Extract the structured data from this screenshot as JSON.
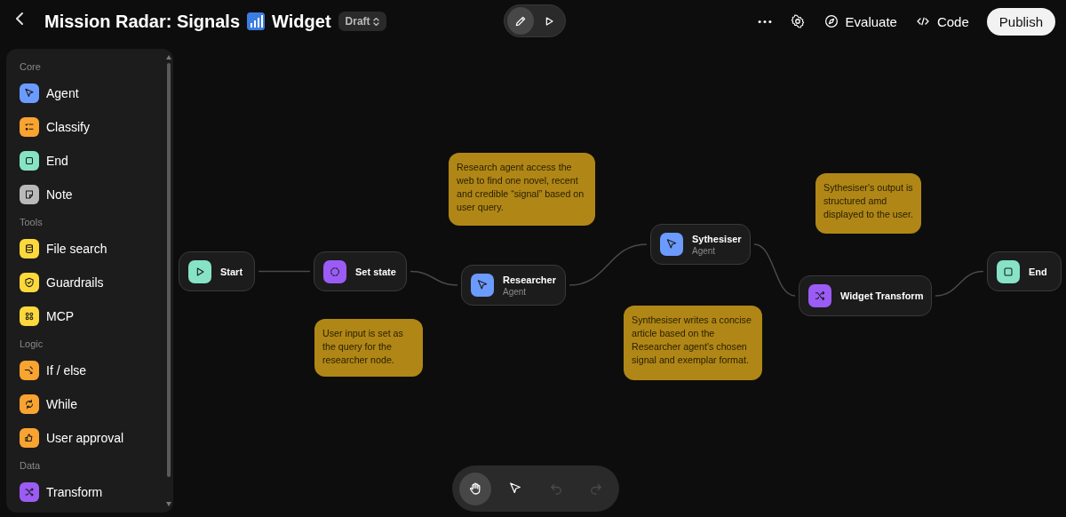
{
  "header": {
    "title_parts": [
      "Mission Radar: Signals",
      "Widget"
    ],
    "status": "Draft",
    "modes": [
      {
        "kind": "edit",
        "selected": true
      },
      {
        "kind": "run",
        "selected": false
      }
    ],
    "actions": [
      {
        "kind": "more"
      },
      {
        "kind": "settings"
      },
      {
        "kind": "evaluate",
        "label": "Evaluate"
      },
      {
        "kind": "code",
        "label": "Code"
      },
      {
        "kind": "publish",
        "label": "Publish"
      }
    ]
  },
  "sidebar": {
    "sections": [
      {
        "title": "Core",
        "items": [
          {
            "label": "Agent",
            "kind": "agent",
            "color": "#6c9bff"
          },
          {
            "label": "Classify",
            "kind": "classify",
            "color": "#f9a431"
          },
          {
            "label": "End",
            "kind": "end",
            "color": "#86e3c5"
          },
          {
            "label": "Note",
            "kind": "note",
            "color": "#b9b9b9"
          }
        ]
      },
      {
        "title": "Tools",
        "items": [
          {
            "label": "File search",
            "kind": "file-search",
            "color": "#fbd83c"
          },
          {
            "label": "Guardrails",
            "kind": "guardrails",
            "color": "#fbd83c"
          },
          {
            "label": "MCP",
            "kind": "mcp",
            "color": "#fbd83c"
          }
        ]
      },
      {
        "title": "Logic",
        "items": [
          {
            "label": "If / else",
            "kind": "if-else",
            "color": "#f9a431"
          },
          {
            "label": "While",
            "kind": "while",
            "color": "#f9a431"
          },
          {
            "label": "User approval",
            "kind": "user-approval",
            "color": "#f9a431"
          }
        ]
      },
      {
        "title": "Data",
        "items": [
          {
            "label": "Transform",
            "kind": "transform",
            "color": "#9b5cf6"
          }
        ]
      }
    ]
  },
  "canvas": {
    "nodes": [
      {
        "label": "Start",
        "kind": "start",
        "color": "#86e3c5"
      },
      {
        "label": "Set state",
        "kind": "set-state",
        "color": "#9b5cf6"
      },
      {
        "label": "Researcher",
        "subtitle": "Agent",
        "kind": "agent",
        "color": "#6c9bff"
      },
      {
        "label": "Sythesiser",
        "subtitle": "Agent",
        "kind": "agent",
        "color": "#6c9bff"
      },
      {
        "label": "Widget Transform",
        "kind": "transform",
        "color": "#9b5cf6"
      },
      {
        "label": "End",
        "kind": "end",
        "color": "#86e3c5"
      }
    ],
    "notes": [
      {
        "text": "Research agent access the web to find one novel, recent and credible “signal” based on user query."
      },
      {
        "text": "User input is set as the query for the researcher node."
      },
      {
        "text": "Sythesiser's output is structured amd displayed to the user."
      },
      {
        "text": "Synthesiser writes a concise article based on the Researcher agent's chosen signal and exemplar format."
      }
    ]
  },
  "toolbar": [
    {
      "kind": "hand",
      "selected": true,
      "disabled": false
    },
    {
      "kind": "pointer",
      "selected": false,
      "disabled": false
    },
    {
      "kind": "undo",
      "selected": false,
      "disabled": true
    },
    {
      "kind": "redo",
      "selected": false,
      "disabled": true
    }
  ]
}
